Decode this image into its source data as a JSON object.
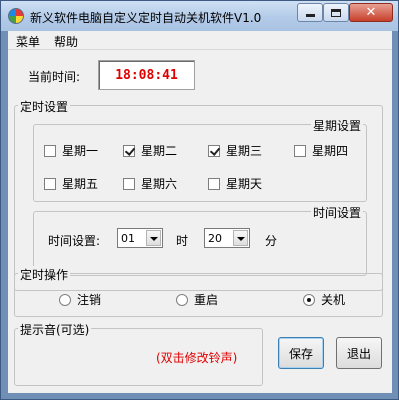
{
  "window": {
    "title": "新义软件电脑自定义定时自动关机软件V1.0",
    "close_glyph": "✕"
  },
  "menu": [
    "菜单",
    "帮助"
  ],
  "current_time": {
    "label": "当前时间:",
    "value": "18:08:41"
  },
  "schedule": {
    "title": "定时设置",
    "weekday_group": {
      "title": "星期设置",
      "days": [
        {
          "label": "星期一",
          "checked": false
        },
        {
          "label": "星期二",
          "checked": true
        },
        {
          "label": "星期三",
          "checked": true
        },
        {
          "label": "星期四",
          "checked": false
        },
        {
          "label": "星期五",
          "checked": false
        },
        {
          "label": "星期六",
          "checked": false
        },
        {
          "label": "星期天",
          "checked": false
        }
      ]
    },
    "time_group": {
      "title": "时间设置",
      "label": "时间设置:",
      "hour_value": "01",
      "hour_unit": "时",
      "minute_value": "20",
      "minute_unit": "分"
    }
  },
  "operation": {
    "title": "定时操作",
    "options": [
      {
        "label": "注销",
        "selected": false
      },
      {
        "label": "重启",
        "selected": false
      },
      {
        "label": "关机",
        "selected": true
      }
    ]
  },
  "sound": {
    "title": "提示音(可选)",
    "hint": "(双击修改铃声)"
  },
  "buttons": {
    "save": "保存",
    "exit": "退出"
  }
}
